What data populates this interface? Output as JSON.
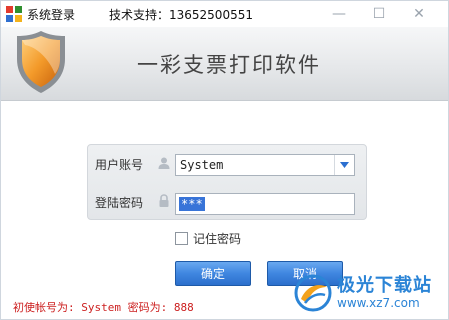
{
  "titlebar": {
    "title": "系统登录",
    "support": "技术支持：13652500551",
    "min_glyph": "—",
    "max_glyph": "☐",
    "close_glyph": "✕"
  },
  "header": {
    "title": "一彩支票打印软件",
    "logo_icon": "shield-icon"
  },
  "form": {
    "user_label": "用户账号",
    "user_value": "System",
    "password_label": "登陆密码",
    "password_value": "***",
    "remember_label": "记住密码",
    "remember_checked": false
  },
  "buttons": {
    "ok": "确定",
    "cancel": "取消"
  },
  "hint": "初使帐号为: System 密码为: 888",
  "watermark": {
    "name": "极光下载站",
    "url": "www.xz7.com"
  },
  "colors": {
    "accent": "#3f86e0",
    "hint": "#cc1f1f",
    "shield": "#f08a1c"
  }
}
